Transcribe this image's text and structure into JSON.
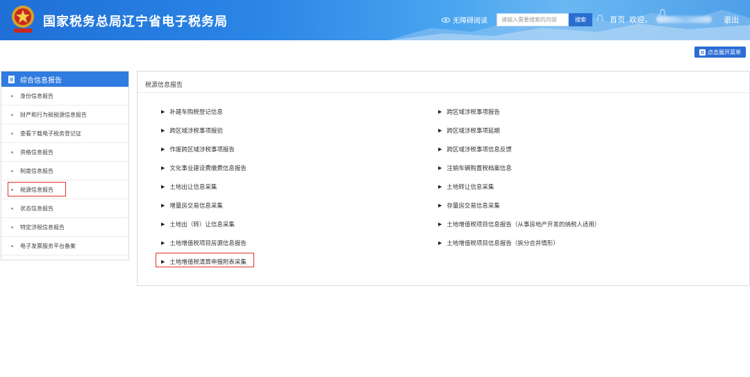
{
  "header": {
    "site_title": "国家税务总局辽宁省电子税务局",
    "accessibility_label": "无障碍阅读",
    "search_placeholder": "请输入需要搜索的内容",
    "search_button": "搜索",
    "home_label": "首页",
    "welcome_label": "欢迎，",
    "separator": "|",
    "logout_label": "退出"
  },
  "toolbar": {
    "expand_menu_label": "点击展开菜单"
  },
  "sidebar": {
    "title": "综合信息报告",
    "items": [
      {
        "label": "身份信息报告"
      },
      {
        "label": "财产和行为税税源信息报告"
      },
      {
        "label": "查看下载电子税务登记证"
      },
      {
        "label": "资格信息报告"
      },
      {
        "label": "制度信息报告"
      },
      {
        "label": "税源信息报告"
      },
      {
        "label": "状态信息报告"
      },
      {
        "label": "特定涉税信息报告"
      },
      {
        "label": "电子发票服务平台备案"
      }
    ],
    "active_index": 5
  },
  "main": {
    "section_title": "税源信息报告",
    "left_items": [
      {
        "label": "补建车购税登记信息"
      },
      {
        "label": "跨区域涉税事项报验"
      },
      {
        "label": "作废跨区域涉税事项报告"
      },
      {
        "label": "文化事业建设费缴费信息报告"
      },
      {
        "label": "土地出让信息采集"
      },
      {
        "label": "增量房交易信息采集"
      },
      {
        "label": "土地出（转）让信息采集"
      },
      {
        "label": "土地增值税项目房源信息报告"
      },
      {
        "label": "土地增值税清算申报附表采集"
      }
    ],
    "right_items": [
      {
        "label": "跨区域涉税事项报告"
      },
      {
        "label": "跨区域涉税事项延期"
      },
      {
        "label": "跨区域涉税事项信息反馈"
      },
      {
        "label": "注销车辆购置税档案信息"
      },
      {
        "label": "土地转让信息采集"
      },
      {
        "label": "存量房交易信息采集"
      },
      {
        "label": "土地增值税项目信息报告（从事房地产开发的纳税人适用）"
      },
      {
        "label": "土地增值税项目信息报告（拆分合并情形）"
      }
    ],
    "arrow_glyph": "▶"
  },
  "colors": {
    "header_blue": "#2b86e6",
    "accent_blue": "#2f7be0",
    "highlight_red": "#e0302a"
  }
}
